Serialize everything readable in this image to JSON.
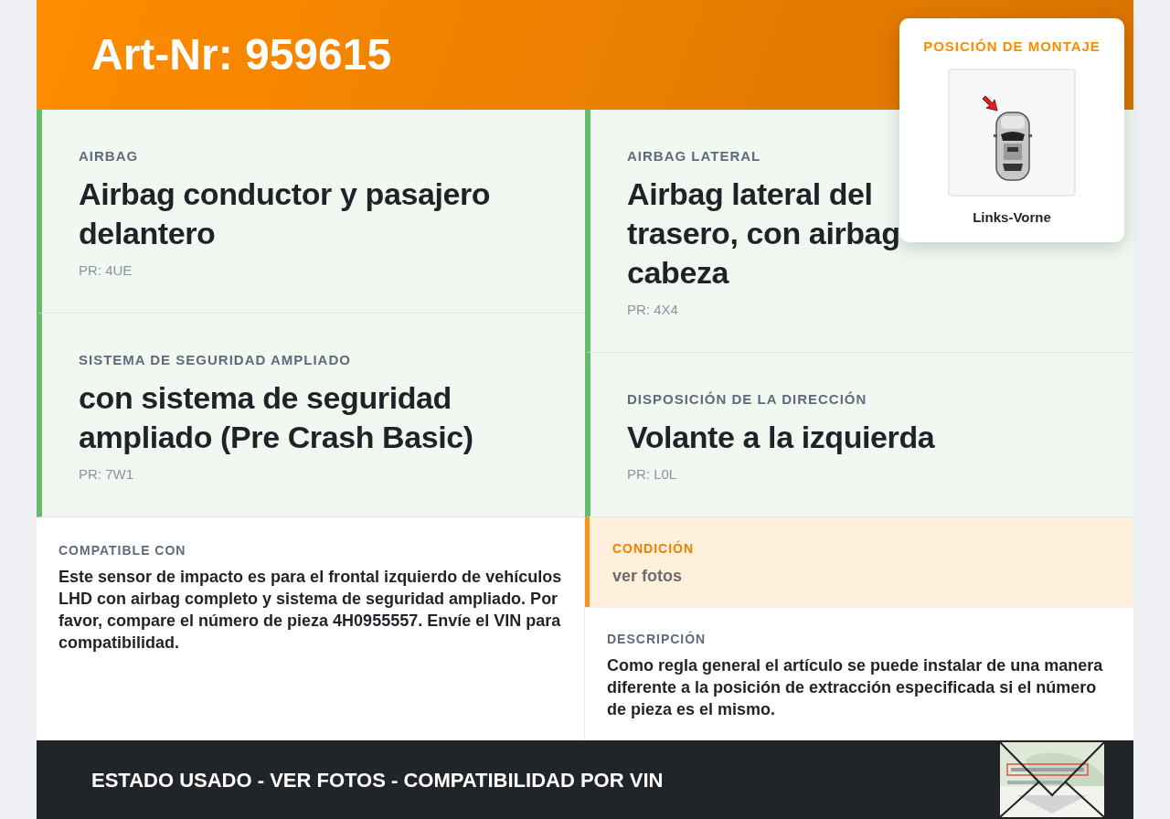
{
  "header": {
    "title": "Art-Nr: 959615"
  },
  "spec_columns": [
    [
      {
        "label": "AIRBAG",
        "title_lines": [
          "Airbag conductor y pasajero delantero"
        ],
        "pr": "PR: 4UE"
      },
      {
        "label": "SISTEMA DE SEGURIDAD AMPLIADO",
        "title_lines": [
          "con sistema de seguridad ampliado (Pre Crash Basic)"
        ],
        "pr": "PR: 7W1"
      }
    ],
    [
      {
        "label": "AIRBAG LATERAL",
        "title_lines": [
          "Airbag lateral del",
          "trasero, con airbag",
          "cabeza"
        ],
        "pr": "PR: 4X4"
      },
      {
        "label": "DISPOSICIÓN DE LA DIRECCIÓN",
        "title_lines": [
          "Volante a la izquierda"
        ],
        "pr": "PR: L0L"
      }
    ]
  ],
  "compatible": {
    "label": "COMPATIBLE CON",
    "text": "Este sensor de impacto es para el frontal izquierdo de vehículos LHD con airbag completo y sistema de seguridad ampliado. Por favor, compare el número de pieza 4H0955557. Envíe el VIN para compatibilidad."
  },
  "condition": {
    "label": "CONDICIÓN",
    "value": "ver fotos"
  },
  "description": {
    "label": "DESCRIPCIÓN",
    "text": "Como regla general el artículo se puede instalar de una manera diferente a la posición de extracción especificada si el número de pieza es el mismo."
  },
  "mounting_position": {
    "title": "POSICIÓN DE MONTAJE",
    "caption": "Links-Vorne"
  },
  "footer": {
    "text": "ESTADO USADO - VER FOTOS - COMPATIBILIDAD POR VIN"
  }
}
